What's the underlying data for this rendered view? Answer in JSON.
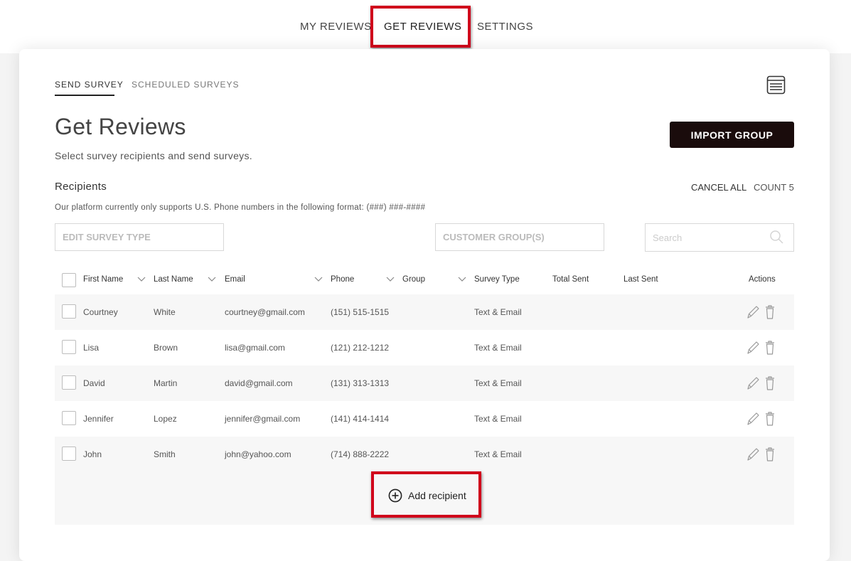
{
  "top_nav": {
    "tabs": [
      {
        "label": "MY REVIEWS"
      },
      {
        "label": "GET REVIEWS"
      },
      {
        "label": "SETTINGS"
      }
    ],
    "active_tab": "GET REVIEWS"
  },
  "sub_nav": {
    "tabs": [
      {
        "label": "SEND SURVEY"
      },
      {
        "label": "SCHEDULED SURVEYS"
      }
    ],
    "active_tab": "SEND SURVEY",
    "preview_icon": "browser-window-icon"
  },
  "header": {
    "title": "Get Reviews",
    "subtitle": "Select survey recipients and send surveys.",
    "import_button": "IMPORT GROUP"
  },
  "recipients": {
    "label": "Recipients",
    "cancel_all": "CANCEL ALL",
    "count": "COUNT 5",
    "note": "Our platform currently only supports U.S. Phone numbers in the following format: (###) ###-####"
  },
  "filters": {
    "survey_type_placeholder": "EDIT SURVEY TYPE",
    "customer_group_placeholder": "CUSTOMER GROUP(S)",
    "search_placeholder": "Search"
  },
  "table": {
    "columns": [
      "First Name",
      "Last Name",
      "Email",
      "Phone",
      "Group",
      "Survey Type",
      "Total Sent",
      "Last Sent",
      "Actions"
    ],
    "rows": [
      {
        "first": "Courtney",
        "last": "White",
        "email": "courtney@gmail.com",
        "phone": "(151) 515-1515",
        "group": "",
        "survey_type": "Text & Email",
        "total_sent": "",
        "last_sent": ""
      },
      {
        "first": "Lisa",
        "last": "Brown",
        "email": "lisa@gmail.com",
        "phone": "(121) 212-1212",
        "group": "",
        "survey_type": "Text & Email",
        "total_sent": "",
        "last_sent": ""
      },
      {
        "first": "David",
        "last": "Martin",
        "email": "david@gmail.com",
        "phone": "(131) 313-1313",
        "group": "",
        "survey_type": "Text & Email",
        "total_sent": "",
        "last_sent": ""
      },
      {
        "first": "Jennifer",
        "last": "Lopez",
        "email": "jennifer@gmail.com",
        "phone": "(141) 414-1414",
        "group": "",
        "survey_type": "Text & Email",
        "total_sent": "",
        "last_sent": ""
      },
      {
        "first": "John",
        "last": "Smith",
        "email": "john@yahoo.com",
        "phone": "(714) 888-2222",
        "group": "",
        "survey_type": "Text & Email",
        "total_sent": "",
        "last_sent": ""
      }
    ],
    "add_recipient": "Add recipient"
  },
  "colors": {
    "highlight": "#d0021b",
    "primary_button": "#1a0c0c",
    "row_alt": "#f7f7f7"
  }
}
